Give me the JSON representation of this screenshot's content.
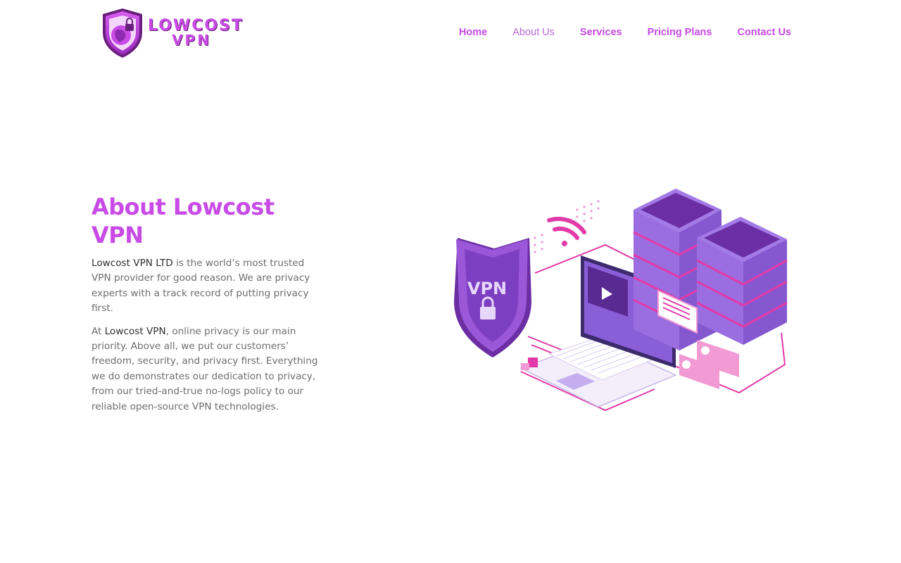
{
  "brand": {
    "line1": "LOWCOST",
    "line2": "VPN",
    "primary_color": "#c84be6",
    "accent_color": "#7b3fb0"
  },
  "nav": {
    "items": [
      {
        "label": "Home"
      },
      {
        "label": "About Us"
      },
      {
        "label": "Services"
      },
      {
        "label": "Pricing Plans"
      },
      {
        "label": "Contact Us"
      }
    ]
  },
  "about": {
    "title": "About Lowcost VPN",
    "p1_strong": "Lowcost VPN LTD",
    "p1_rest": " is the world’s most trusted VPN provider for good reason. We are privacy experts with a track record of putting privacy first.",
    "p2_start": "At ",
    "p2_strong": "Lowcost VPN",
    "p2_rest": ", online privacy is our main priority. Above all, we put our customers’ freedom, security, and privacy first. Everything we do demonstrates our dedication to privacy, from our tried-and-true no-logs policy to our reliable open-source VPN technologies."
  },
  "illustration": {
    "shield_text": "VPN",
    "icons": [
      "shield-lock-icon",
      "wifi-icon",
      "laptop-icon",
      "server-icon",
      "play-icon",
      "user-card-icon"
    ]
  }
}
